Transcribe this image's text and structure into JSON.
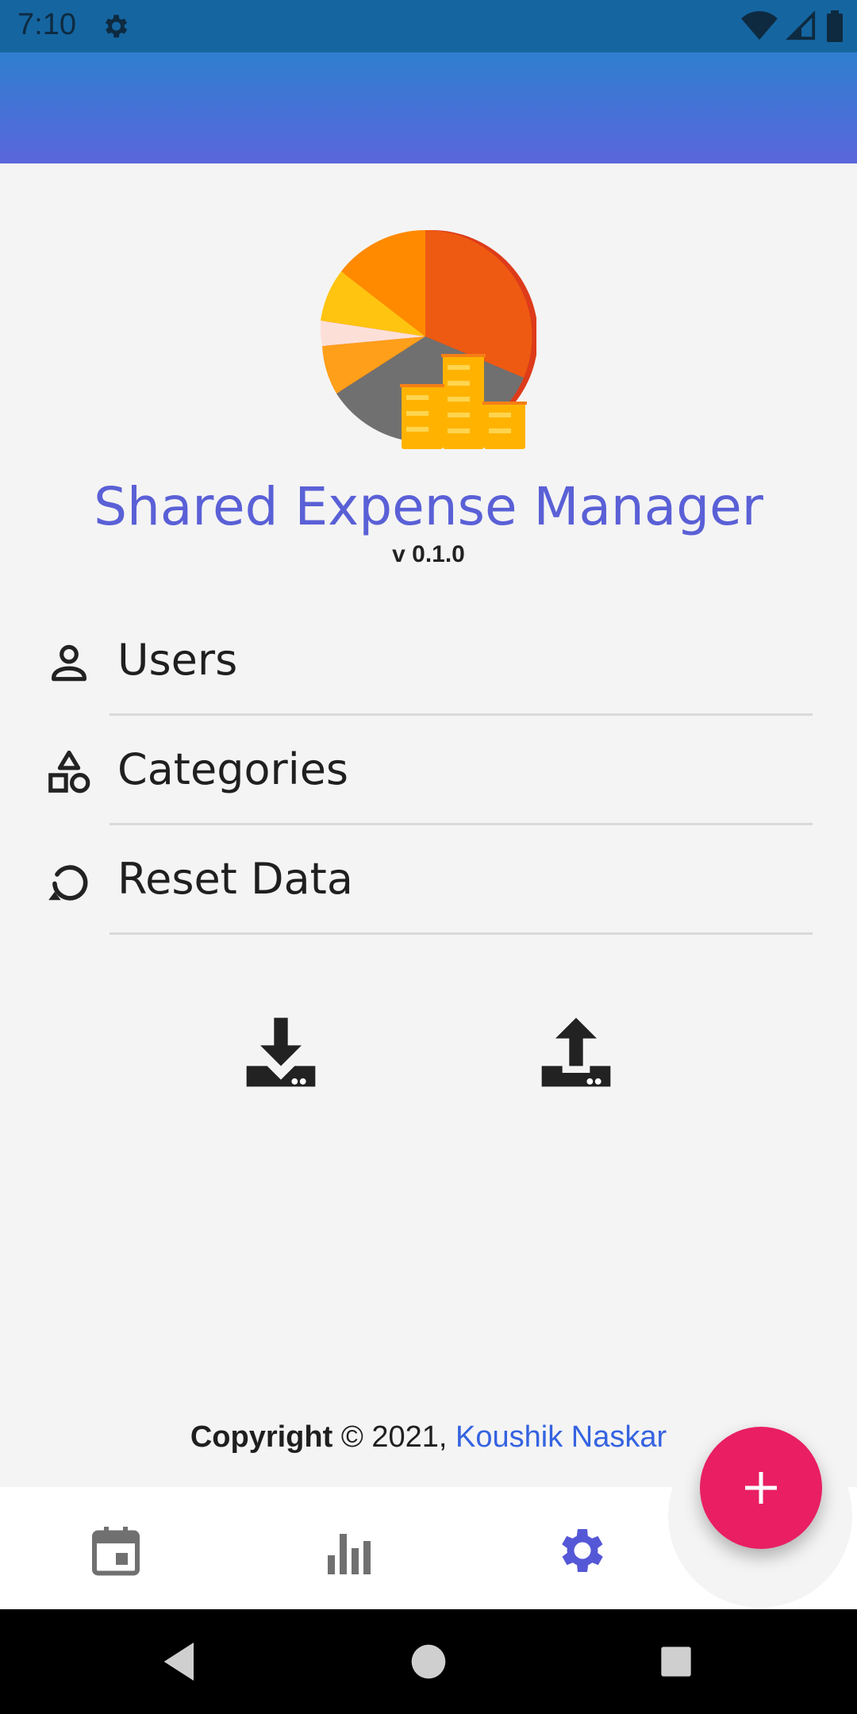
{
  "status_bar": {
    "time": "7:10",
    "settings_icon": "gear-icon"
  },
  "app": {
    "title": "Shared Expense Manager",
    "version": "v 0.1.0"
  },
  "menu": [
    {
      "label": "Users",
      "icon": "person-icon"
    },
    {
      "label": "Categories",
      "icon": "shapes-icon"
    },
    {
      "label": "Reset Data",
      "icon": "restore-icon"
    }
  ],
  "actions": {
    "import_icon": "download-icon",
    "export_icon": "upload-icon"
  },
  "footer": {
    "copyright_label": "Copyright",
    "copyright_rest": "© 2021, ",
    "author": "Koushik Naskar"
  },
  "bottom_nav": [
    {
      "name": "calendar",
      "icon": "calendar-icon"
    },
    {
      "name": "stats",
      "icon": "bar-chart-icon"
    },
    {
      "name": "settings",
      "icon": "settings-icon",
      "active": true
    }
  ],
  "fab": {
    "icon": "plus-icon"
  },
  "colors": {
    "accent": "#5a60d6",
    "fab": "#e91e63",
    "active_nav": "#5558d6",
    "link": "#3563e0"
  }
}
